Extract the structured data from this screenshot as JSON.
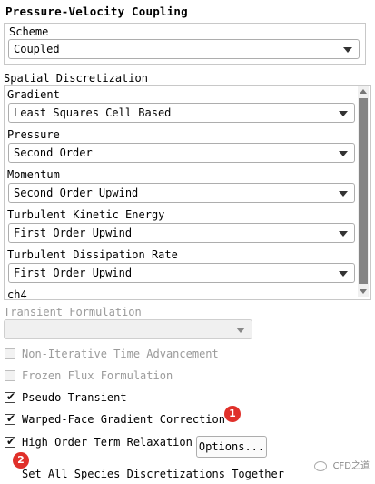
{
  "pressure_velocity": {
    "title": "Pressure-Velocity Coupling",
    "scheme_label": "Scheme",
    "scheme_value": "Coupled"
  },
  "spatial": {
    "title": "Spatial Discretization",
    "items": [
      {
        "label": "Gradient",
        "value": "Least Squares Cell Based"
      },
      {
        "label": "Pressure",
        "value": "Second Order"
      },
      {
        "label": "Momentum",
        "value": "Second Order Upwind"
      },
      {
        "label": "Turbulent Kinetic Energy",
        "value": "First Order Upwind"
      },
      {
        "label": "Turbulent Dissipation Rate",
        "value": "First Order Upwind"
      },
      {
        "label": "ch4",
        "value": ""
      }
    ]
  },
  "transient": {
    "label": "Transient Formulation",
    "value": ""
  },
  "options": [
    {
      "label": "Non-Iterative Time Advancement",
      "checked": false,
      "enabled": false
    },
    {
      "label": "Frozen Flux Formulation",
      "checked": false,
      "enabled": false
    },
    {
      "label": "Pseudo Transient",
      "checked": true,
      "enabled": true
    },
    {
      "label": "Warped-Face Gradient Correction",
      "checked": true,
      "enabled": true
    },
    {
      "label": "High Order Term Relaxation",
      "checked": true,
      "enabled": true
    },
    {
      "label": "Set All Species Discretizations Together",
      "checked": false,
      "enabled": true
    }
  ],
  "options_button": "Options...",
  "badges": {
    "first": "1",
    "second": "2"
  },
  "watermark": "CFD之道",
  "colors": {
    "badge": "#e0302a",
    "scroll_thumb": "#858585"
  }
}
